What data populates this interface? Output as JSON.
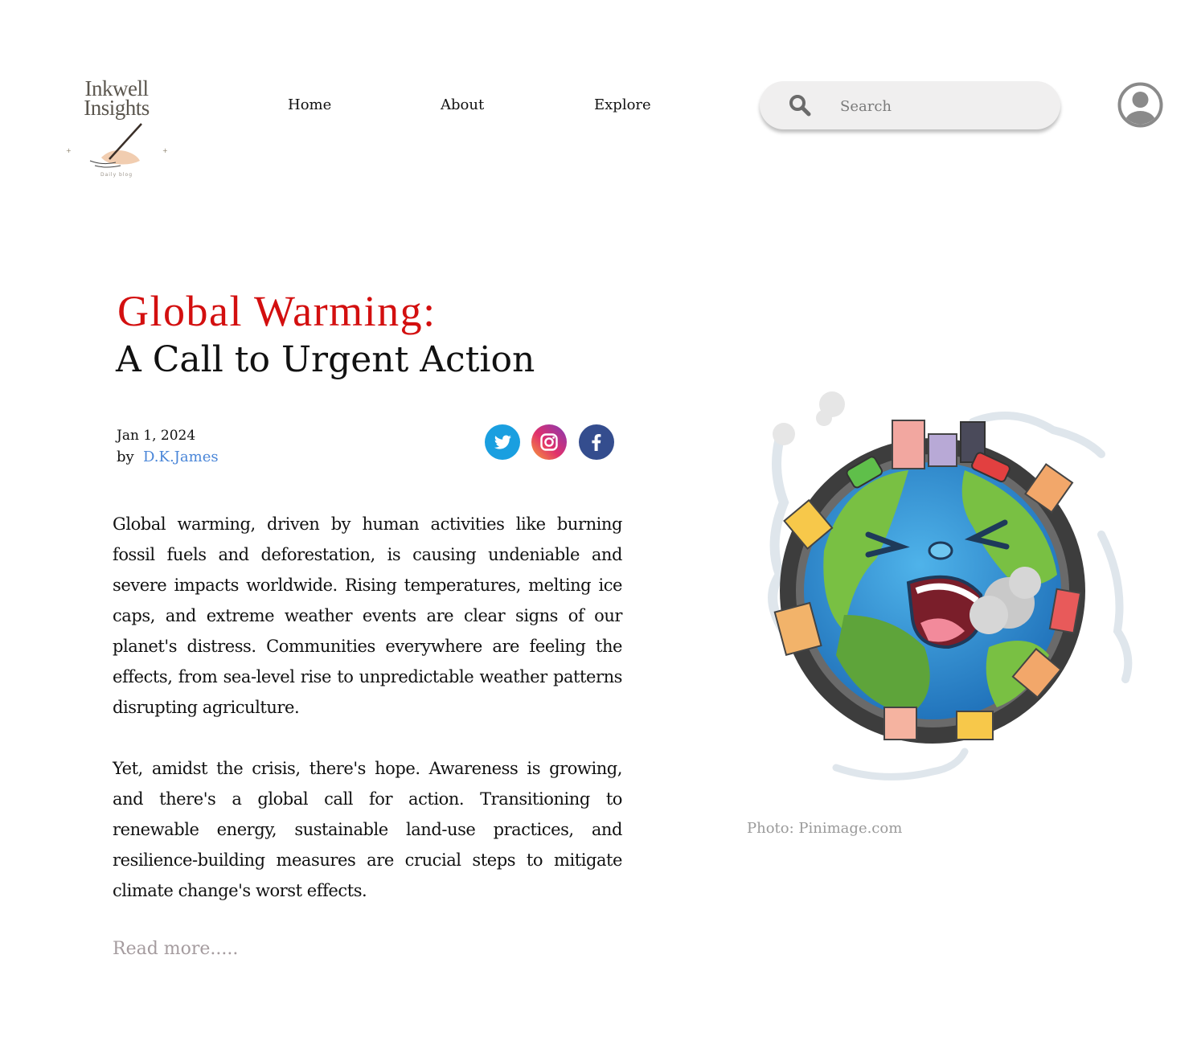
{
  "logo": {
    "line1": "Inkwell",
    "line2": "Insights",
    "tagline": "Daily blog"
  },
  "nav": {
    "home": "Home",
    "about": "About",
    "explore": "Explore"
  },
  "search": {
    "placeholder": "Search",
    "icon": "search-icon"
  },
  "user": {
    "icon": "user-avatar-icon"
  },
  "article": {
    "title_part1": "Global Warming:",
    "title_part2": "A Call to Urgent Action",
    "date": "Jan 1, 2024",
    "by_label": "by",
    "author": "D.K.James",
    "paragraph1": "Global warming, driven by human activities like burning fossil fuels and deforestation, is causing undeniable and severe impacts worldwide. Rising temperatures, melting ice caps, and extreme weather events are clear signs of our planet's distress. Communities everywhere are feeling the effects, from sea-level rise to unpredictable weather patterns disrupting agriculture.",
    "paragraph2": "Yet, amidst the crisis, there's hope. Awareness is growing, and there's a global call for action. Transitioning to renewable energy, sustainable land-use practices, and resilience-building measures are crucial steps to mitigate climate change's worst effects.",
    "read_more": "Read more.....",
    "photo_caption": "Photo: Pinimage.com"
  },
  "social": [
    {
      "name": "twitter-icon",
      "color": "#1da1f2"
    },
    {
      "name": "instagram-icon",
      "color": "#c13584"
    },
    {
      "name": "facebook-icon",
      "color": "#3b5998"
    }
  ],
  "colors": {
    "title_red": "#d30f0f",
    "author_link": "#4a86d8",
    "read_more": "#a59c9f",
    "caption": "#9a9a9a"
  }
}
